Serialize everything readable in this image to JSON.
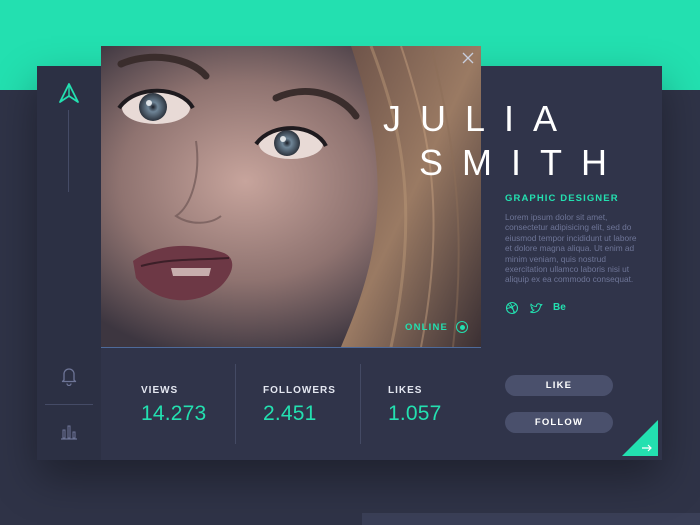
{
  "profile": {
    "first_name": "JULIA",
    "last_name": "SMITH",
    "role": "GRAPHIC DESIGNER",
    "bio": "Lorem ipsum dolor sit amet, consectetur adipisicing elit, sed do eiusmod tempor incididunt ut labore et dolore magna aliqua. Ut enim ad minim veniam, quis nostrud exercitation ullamco laboris nisi ut aliquip ex ea commodo consequat.",
    "status": "ONLINE"
  },
  "socials": {
    "items": [
      "dribbble-icon",
      "twitter-icon",
      "behance-icon"
    ],
    "behance_label": "Be"
  },
  "stats": [
    {
      "label": "VIEWS",
      "value": "14.273"
    },
    {
      "label": "FOLLOWERS",
      "value": "2.451"
    },
    {
      "label": "LIKES",
      "value": "1.057"
    }
  ],
  "actions": {
    "like_label": "LIKE",
    "follow_label": "FOLLOW"
  },
  "sidebar": {
    "icons": [
      "logo-icon",
      "bell-icon",
      "bar-chart-icon"
    ]
  },
  "colors": {
    "accent": "#23e0b0",
    "background": "#2f3347",
    "card": "#30344a",
    "sidebar": "#2c3044",
    "button": "#4a506c",
    "muted_text": "#6e7597"
  }
}
